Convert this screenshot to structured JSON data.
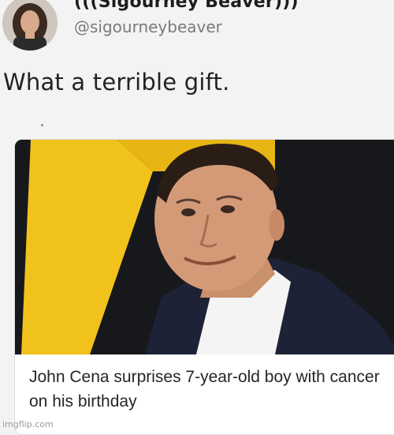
{
  "author": {
    "display_name": "(((Sigourney Beaver)))",
    "handle": "@sigourneybeaver"
  },
  "tweet": {
    "text": "What a terrible gift."
  },
  "card": {
    "headline": "John Cena surprises 7-year-old boy with cancer on his birthday"
  },
  "watermark": "imgflip.com",
  "colors": {
    "background": "#f3f3f3",
    "photo_backdrop_yellow": "#f2c21c",
    "photo_backdrop_dark": "#16171a",
    "suit": "#1d2236"
  },
  "icons": {
    "avatar": "profile-photo",
    "card_image": "news-photo-man-in-suit"
  }
}
